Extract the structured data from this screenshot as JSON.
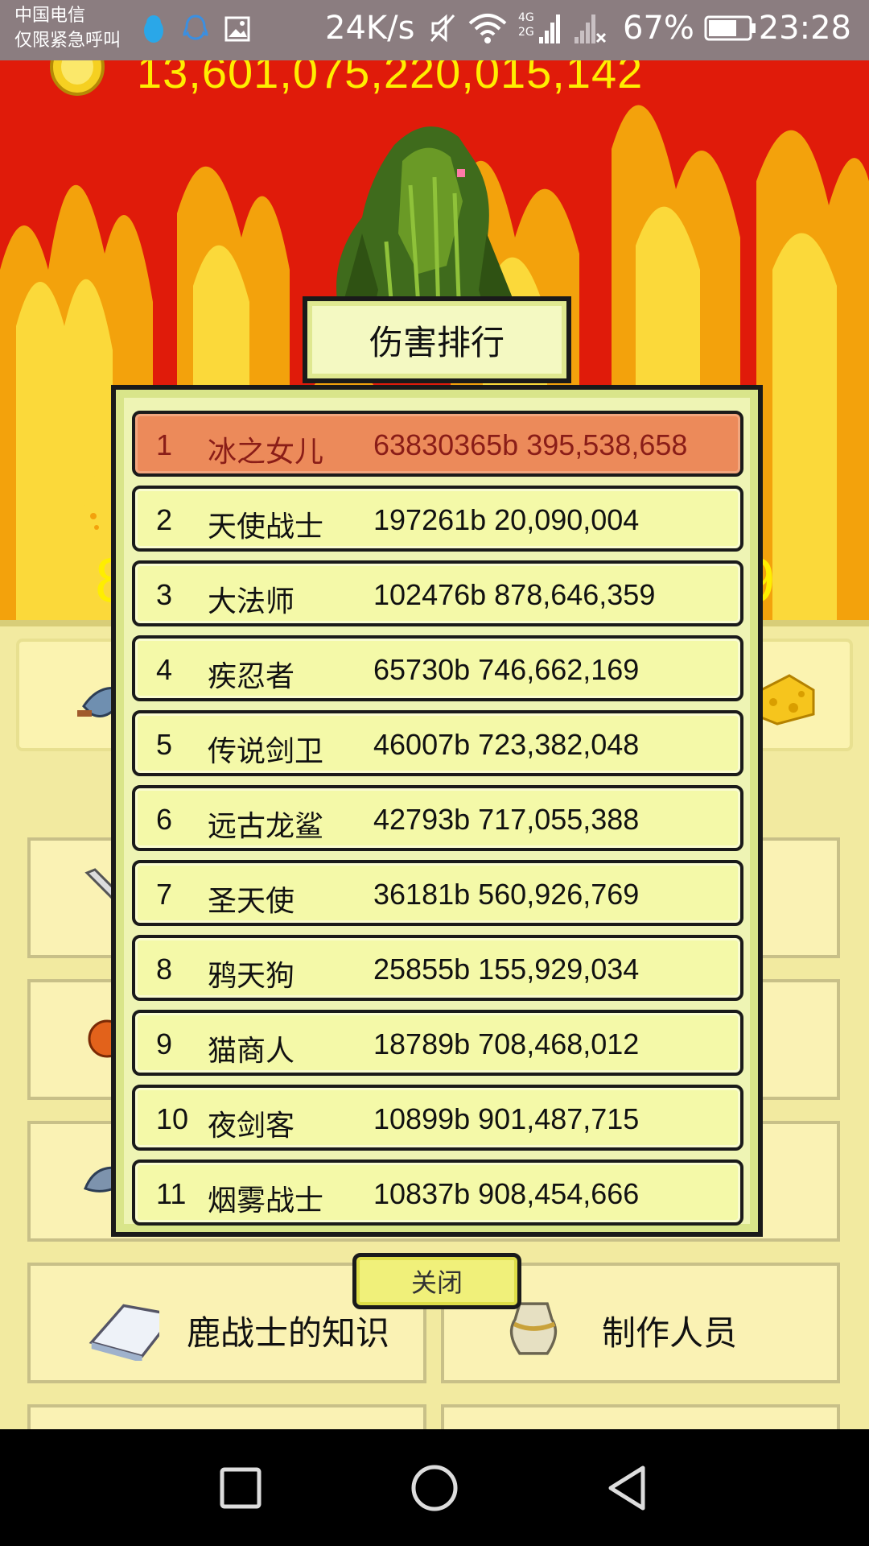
{
  "status_bar": {
    "carrier_line1": "中国电信",
    "carrier_line2": "仅限紧急呼叫",
    "net_speed": "24K/s",
    "battery": "67%",
    "time": "23:28",
    "icons": [
      "penguin-icon",
      "qq-icon",
      "image-icon",
      "mute-icon",
      "wifi-icon",
      "signal-4g-icon",
      "signal-off-icon",
      "battery-icon"
    ]
  },
  "game": {
    "gold": "13,601,075,220,015,142",
    "hp_left_partial": "8",
    "hp_right_partial": "9",
    "accent_red": "#e01b0a",
    "accent_yellow": "#ffee00"
  },
  "background_menu": {
    "tiles": [
      {
        "label": "鹿战士的知识"
      },
      {
        "label": "制作人员"
      }
    ]
  },
  "dialog": {
    "title": "伤害排行",
    "close_label": "关闭",
    "ranking": [
      {
        "rank": "1",
        "name": "冰之女儿",
        "damage": "63830365b 395,538,658"
      },
      {
        "rank": "2",
        "name": "天使战士",
        "damage": "197261b 20,090,004"
      },
      {
        "rank": "3",
        "name": "大法师",
        "damage": "102476b 878,646,359"
      },
      {
        "rank": "4",
        "name": "疾忍者",
        "damage": "65730b 746,662,169"
      },
      {
        "rank": "5",
        "name": "传说剑卫",
        "damage": "46007b 723,382,048"
      },
      {
        "rank": "6",
        "name": "远古龙鲨",
        "damage": "42793b 717,055,388"
      },
      {
        "rank": "7",
        "name": "圣天使",
        "damage": "36181b 560,926,769"
      },
      {
        "rank": "8",
        "name": "鸦天狗",
        "damage": "25855b 155,929,034"
      },
      {
        "rank": "9",
        "name": "猫商人",
        "damage": "18789b 708,468,012"
      },
      {
        "rank": "10",
        "name": "夜剑客",
        "damage": "10899b 901,487,715"
      },
      {
        "rank": "11",
        "name": "烟雾战士",
        "damage": "10837b 908,454,666"
      }
    ]
  },
  "nav": {
    "buttons": [
      "recents-button",
      "home-button",
      "back-button"
    ]
  }
}
